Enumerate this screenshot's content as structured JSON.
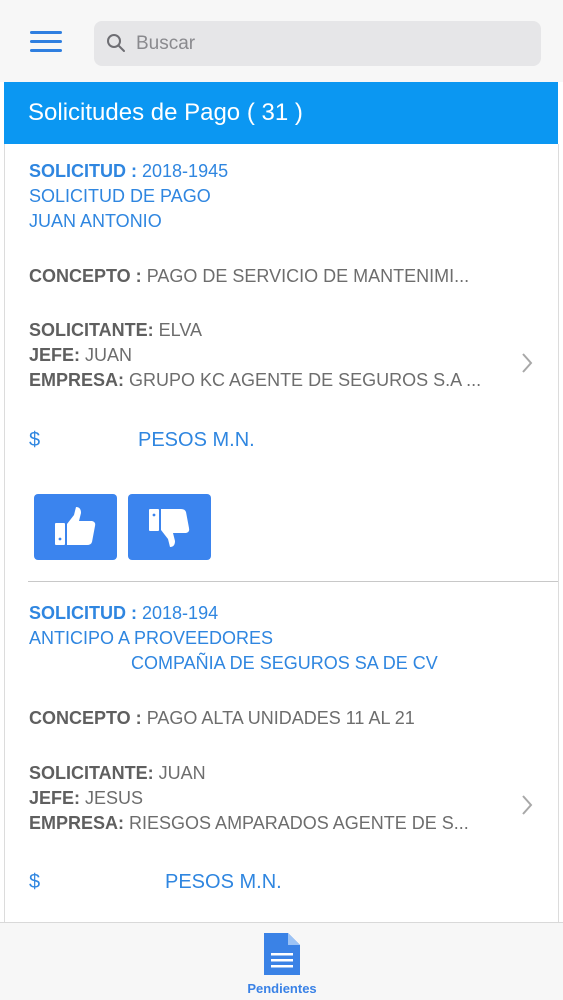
{
  "search": {
    "placeholder": "Buscar"
  },
  "header": {
    "title": "Solicitudes de Pago ( 31 )"
  },
  "labels": {
    "solicitud": "SOLICITUD :",
    "concepto": "CONCEPTO :",
    "solicitante": "SOLICITANTE:",
    "jefe": "JEFE:",
    "empresa": "EMPRESA:",
    "currency_symbol": "$"
  },
  "requests": [
    {
      "folio": "2018-1945",
      "tipo": "SOLICITUD DE PAGO",
      "beneficiario": "JUAN ANTONIO",
      "concepto": "PAGO DE SERVICIO DE MANTENIMI...",
      "solicitante": "ELVA",
      "jefe": "JUAN",
      "empresa": "GRUPO KC AGENTE DE SEGUROS S.A ...",
      "moneda": "PESOS M.N."
    },
    {
      "folio": "2018-194",
      "tipo": "ANTICIPO A PROVEEDORES",
      "beneficiario": "COMPAÑIA DE SEGUROS SA DE CV",
      "concepto": "PAGO ALTA UNIDADES 11 AL 21",
      "solicitante": "JUAN",
      "jefe": "JESUS",
      "empresa": "RIESGOS AMPARADOS AGENTE DE S...",
      "moneda": "PESOS M.N."
    }
  ],
  "actions": {
    "approve_icon": "thumbs-up-icon",
    "reject_icon": "thumbs-down-icon"
  },
  "bottom_nav": {
    "tab_label": "Pendientes",
    "tab_icon": "document-icon"
  },
  "colors": {
    "accent": "#0b97f2",
    "link_blue": "#2f86e0",
    "button_blue": "#3b84ee"
  }
}
